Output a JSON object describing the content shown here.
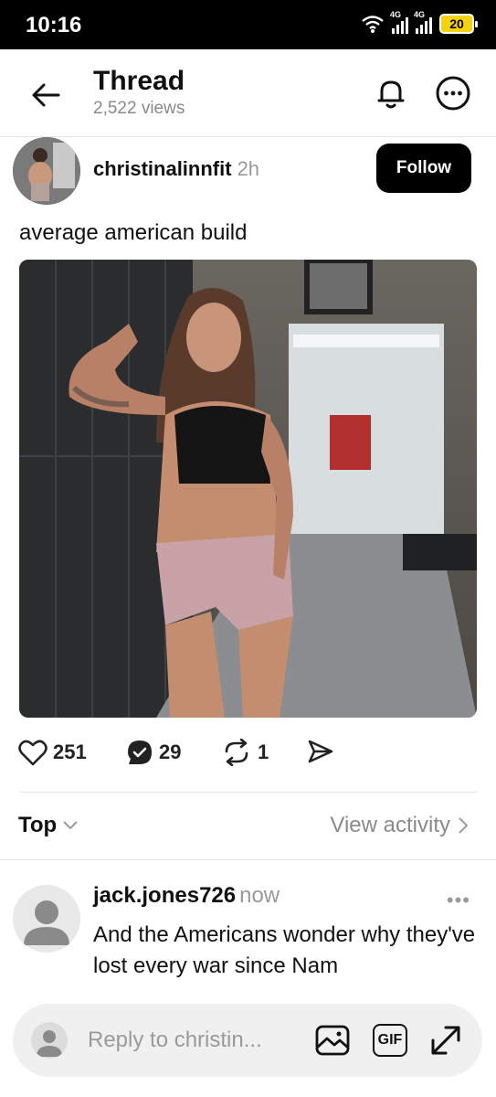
{
  "status_bar": {
    "time": "10:16",
    "network_1": "4G",
    "network_2": "4G",
    "battery": "20"
  },
  "header": {
    "title": "Thread",
    "views": "2,522 views"
  },
  "post": {
    "author": "christinalinnfit",
    "time": "2h",
    "follow_label": "Follow",
    "caption": "average american build",
    "likes": "251",
    "replies": "29",
    "reposts": "1"
  },
  "sort": {
    "label": "Top",
    "view_activity": "View activity"
  },
  "reply": {
    "user": "jack.jones726",
    "time": "now",
    "more": "•••",
    "text": "And the Americans wonder why they've lost every war since Nam"
  },
  "composer": {
    "placeholder": "Reply to christin...",
    "gif_label": "GIF"
  }
}
